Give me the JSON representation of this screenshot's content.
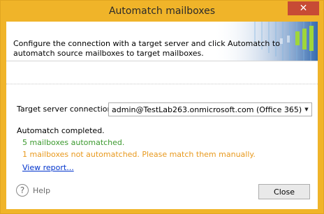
{
  "window": {
    "title": "Automatch mailboxes",
    "close_glyph": "✕"
  },
  "header": {
    "description": "Configure the connection with a target server and click Automatch to automatch source mailboxes to target mailboxes."
  },
  "server": {
    "label": "Target server connection:",
    "value": "admin@TestLab263.onmicrosoft.com (Office 365)",
    "dropdown_icon": "chevron-down-icon"
  },
  "status": {
    "title": "Automatch completed.",
    "ok_text": "5 mailboxes automatched.",
    "warn_text": "1 mailboxes not automatched. Please match them manually.",
    "report_link": "View report...",
    "colors": {
      "ok": "#3c9a2f",
      "warn": "#e8991d",
      "link": "#0033cc"
    }
  },
  "footer": {
    "help_label": "Help",
    "help_glyph": "?",
    "close_label": "Close"
  },
  "colors": {
    "frame": "#f0b429",
    "close_x": "#c74b35"
  }
}
